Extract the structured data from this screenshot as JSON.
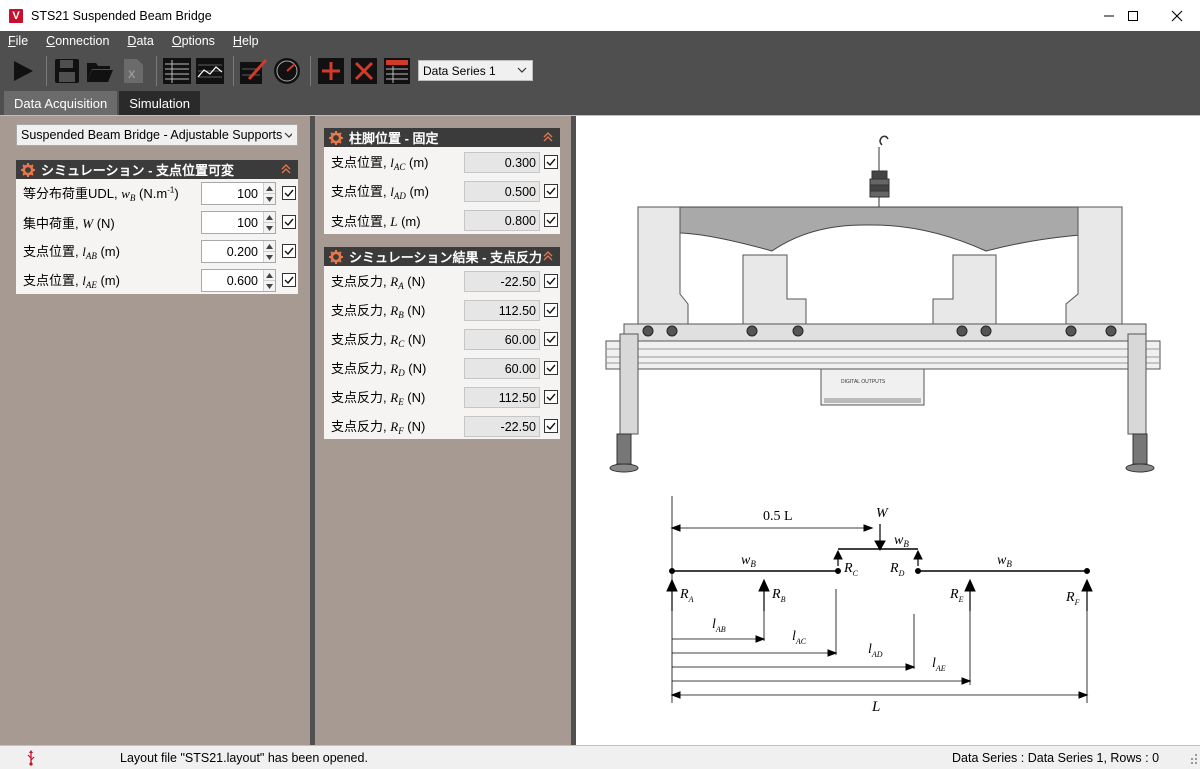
{
  "window": {
    "title": "STS21 Suspended Beam Bridge",
    "icon_letter": "V"
  },
  "menu": [
    {
      "label": "File",
      "key": "F",
      "rest": "ile"
    },
    {
      "label": "Connection",
      "key": "C",
      "rest": "onnection"
    },
    {
      "label": "Data",
      "key": "D",
      "rest": "ata"
    },
    {
      "label": "Options",
      "key": "O",
      "rest": "ptions"
    },
    {
      "label": "Help",
      "key": "H",
      "rest": "elp"
    }
  ],
  "toolbar": {
    "icons": [
      "play-icon",
      "save-icon",
      "open-folder-icon",
      "export-excel-icon",
      "table-view-icon",
      "graph-view-icon",
      "edit-graph-icon",
      "meter-icon",
      "add-row-icon",
      "delete-row-icon",
      "table-settings-icon"
    ],
    "data_series_select": "Data Series 1"
  },
  "tabs": [
    {
      "label": "Data Acquisition",
      "active": false
    },
    {
      "label": "Simulation",
      "active": true
    }
  ],
  "left": {
    "model_select": "Suspended Beam Bridge - Adjustable Supports",
    "group_title": "シミュレーション - 支点位置可変",
    "rows": [
      {
        "label_pre": "等分布荷重UDL, ",
        "sym": "w",
        "sub": "B",
        "label_post": " (N.m",
        "sup": "-1",
        "tail": ")",
        "value": "100",
        "checked": true
      },
      {
        "label_pre": "集中荷重, ",
        "sym": "W",
        "sub": "",
        "label_post": " (N)",
        "sup": "",
        "tail": "",
        "value": "100",
        "checked": true
      },
      {
        "label_pre": "支点位置, ",
        "sym": "l",
        "sub": "AB",
        "label_post": " (m)",
        "sup": "",
        "tail": "",
        "value": "0.200",
        "checked": true
      },
      {
        "label_pre": "支点位置, ",
        "sym": "l",
        "sub": "AE",
        "label_post": " (m)",
        "sup": "",
        "tail": "",
        "value": "0.600",
        "checked": true
      }
    ]
  },
  "middle": {
    "fixed_title": "柱脚位置 - 固定",
    "fixed_rows": [
      {
        "label_pre": "支点位置, ",
        "sym": "l",
        "sub": "AC",
        "label_post": " (m)",
        "value": "0.300",
        "checked": true
      },
      {
        "label_pre": "支点位置, ",
        "sym": "l",
        "sub": "AD",
        "label_post": " (m)",
        "value": "0.500",
        "checked": true
      },
      {
        "label_pre": "支点位置, ",
        "sym": "L",
        "sub": "",
        "label_post": " (m)",
        "value": "0.800",
        "checked": true
      }
    ],
    "result_title": "シミュレーション結果 - 支点反力",
    "result_rows": [
      {
        "label_pre": "支点反力, ",
        "sym": "R",
        "sub": "A",
        "label_post": " (N)",
        "value": "-22.50",
        "checked": true
      },
      {
        "label_pre": "支点反力, ",
        "sym": "R",
        "sub": "B",
        "label_post": " (N)",
        "value": "112.50",
        "checked": true
      },
      {
        "label_pre": "支点反力, ",
        "sym": "R",
        "sub": "C",
        "label_post": " (N)",
        "value": "60.00",
        "checked": true
      },
      {
        "label_pre": "支点反力, ",
        "sym": "R",
        "sub": "D",
        "label_post": " (N)",
        "value": "60.00",
        "checked": true
      },
      {
        "label_pre": "支点反力, ",
        "sym": "R",
        "sub": "E",
        "label_post": " (N)",
        "value": "112.50",
        "checked": true
      },
      {
        "label_pre": "支点反力, ",
        "sym": "R",
        "sub": "F",
        "label_post": " (N)",
        "value": "-22.50",
        "checked": true
      }
    ]
  },
  "device_panel": {
    "label": "DIGITAL OUTPUTS"
  },
  "diagram": {
    "half_span": "0.5 L",
    "load_W": "W",
    "udl_w": "w",
    "udl_sub": "B",
    "span_L": "L",
    "reactions": [
      {
        "sym": "R",
        "sub": "A"
      },
      {
        "sym": "R",
        "sub": "B"
      },
      {
        "sym": "R",
        "sub": "C"
      },
      {
        "sym": "R",
        "sub": "D"
      },
      {
        "sym": "R",
        "sub": "E"
      },
      {
        "sym": "R",
        "sub": "F"
      }
    ],
    "dims": [
      {
        "sym": "l",
        "sub": "AB"
      },
      {
        "sym": "l",
        "sub": "AC"
      },
      {
        "sym": "l",
        "sub": "AD"
      },
      {
        "sym": "l",
        "sub": "AE"
      }
    ]
  },
  "status": {
    "message": "Layout file \"STS21.layout\" has been opened.",
    "series": "Data Series : Data Series 1,  Rows : 0"
  },
  "colors": {
    "panel_bg": "#a69a93",
    "dark_bar": "#4f4f4f",
    "group_header": "#3b3b3b",
    "gear_accent": "#e8784a",
    "brand_red": "#c8102e"
  }
}
